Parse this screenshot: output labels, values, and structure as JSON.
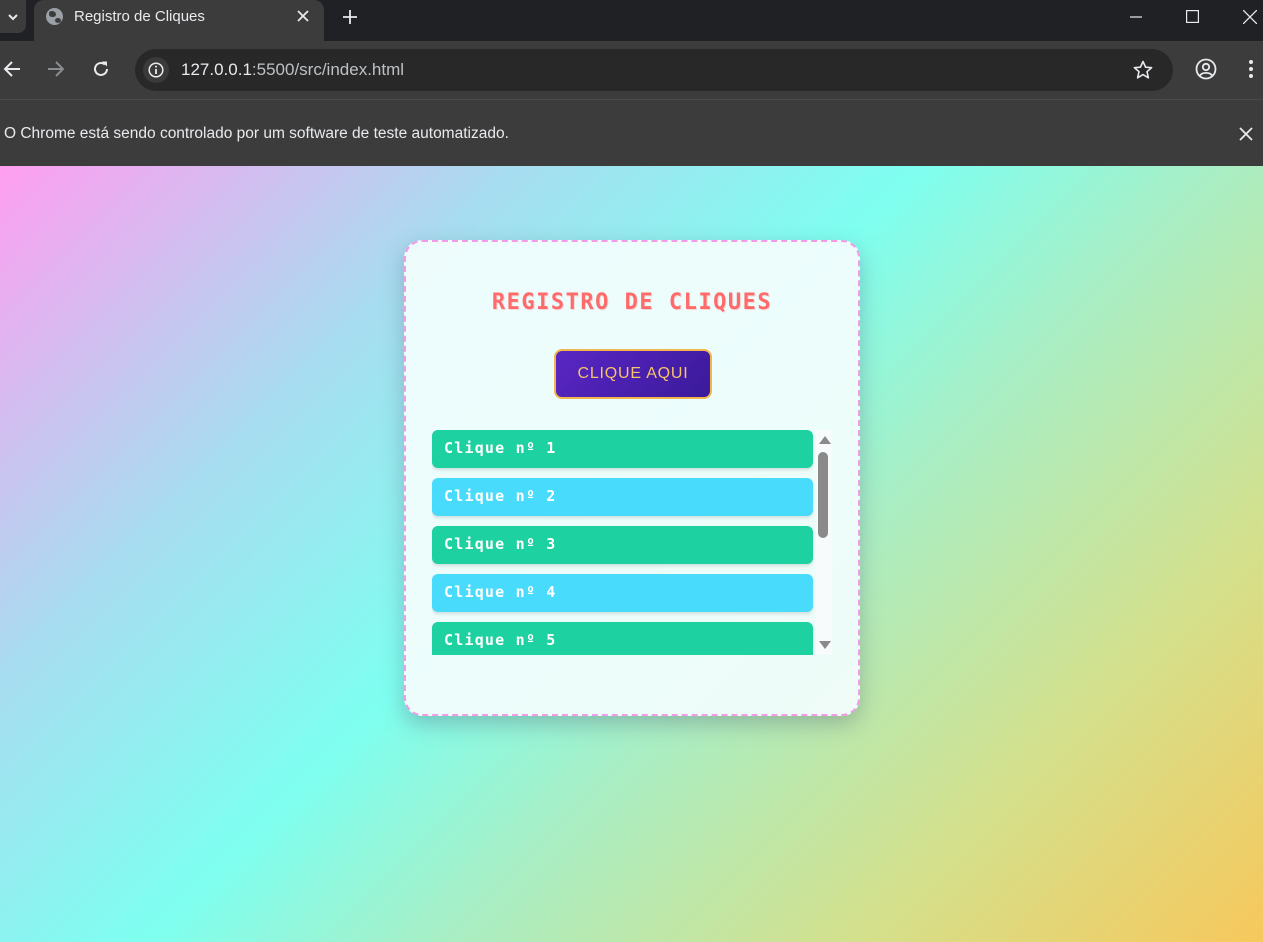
{
  "browser": {
    "tab_title": "Registro de Cliques",
    "url_host": "127.0.0.1",
    "url_path": ":5500/src/index.html",
    "infobar_message": "O Chrome está sendo controlado por um software de teste automatizado."
  },
  "icons": {
    "favicon": "globe-icon",
    "tab_close": "close-icon",
    "new_tab": "plus-icon",
    "back": "arrow-left-icon",
    "forward": "arrow-right-icon",
    "reload": "reload-icon",
    "site_info": "info-icon",
    "bookmark": "star-icon",
    "profile": "profile-icon",
    "menu": "kebab-menu-icon"
  },
  "page": {
    "title": "REGISTRO DE CLIQUES",
    "button_label": "CLIQUE AQUI",
    "clicks": [
      {
        "label": "Clique nº 1",
        "color": "#1dd1a1"
      },
      {
        "label": "Clique nº 2",
        "color": "#48dbfb"
      },
      {
        "label": "Clique nº 3",
        "color": "#1dd1a1"
      },
      {
        "label": "Clique nº 4",
        "color": "#48dbfb"
      },
      {
        "label": "Clique nº 5",
        "color": "#1dd1a1"
      }
    ]
  },
  "colors": {
    "title": "#ff6b6b",
    "button_bg": "#4b22b0",
    "button_border": "#f2b64f",
    "card_border": "#f39be8"
  }
}
